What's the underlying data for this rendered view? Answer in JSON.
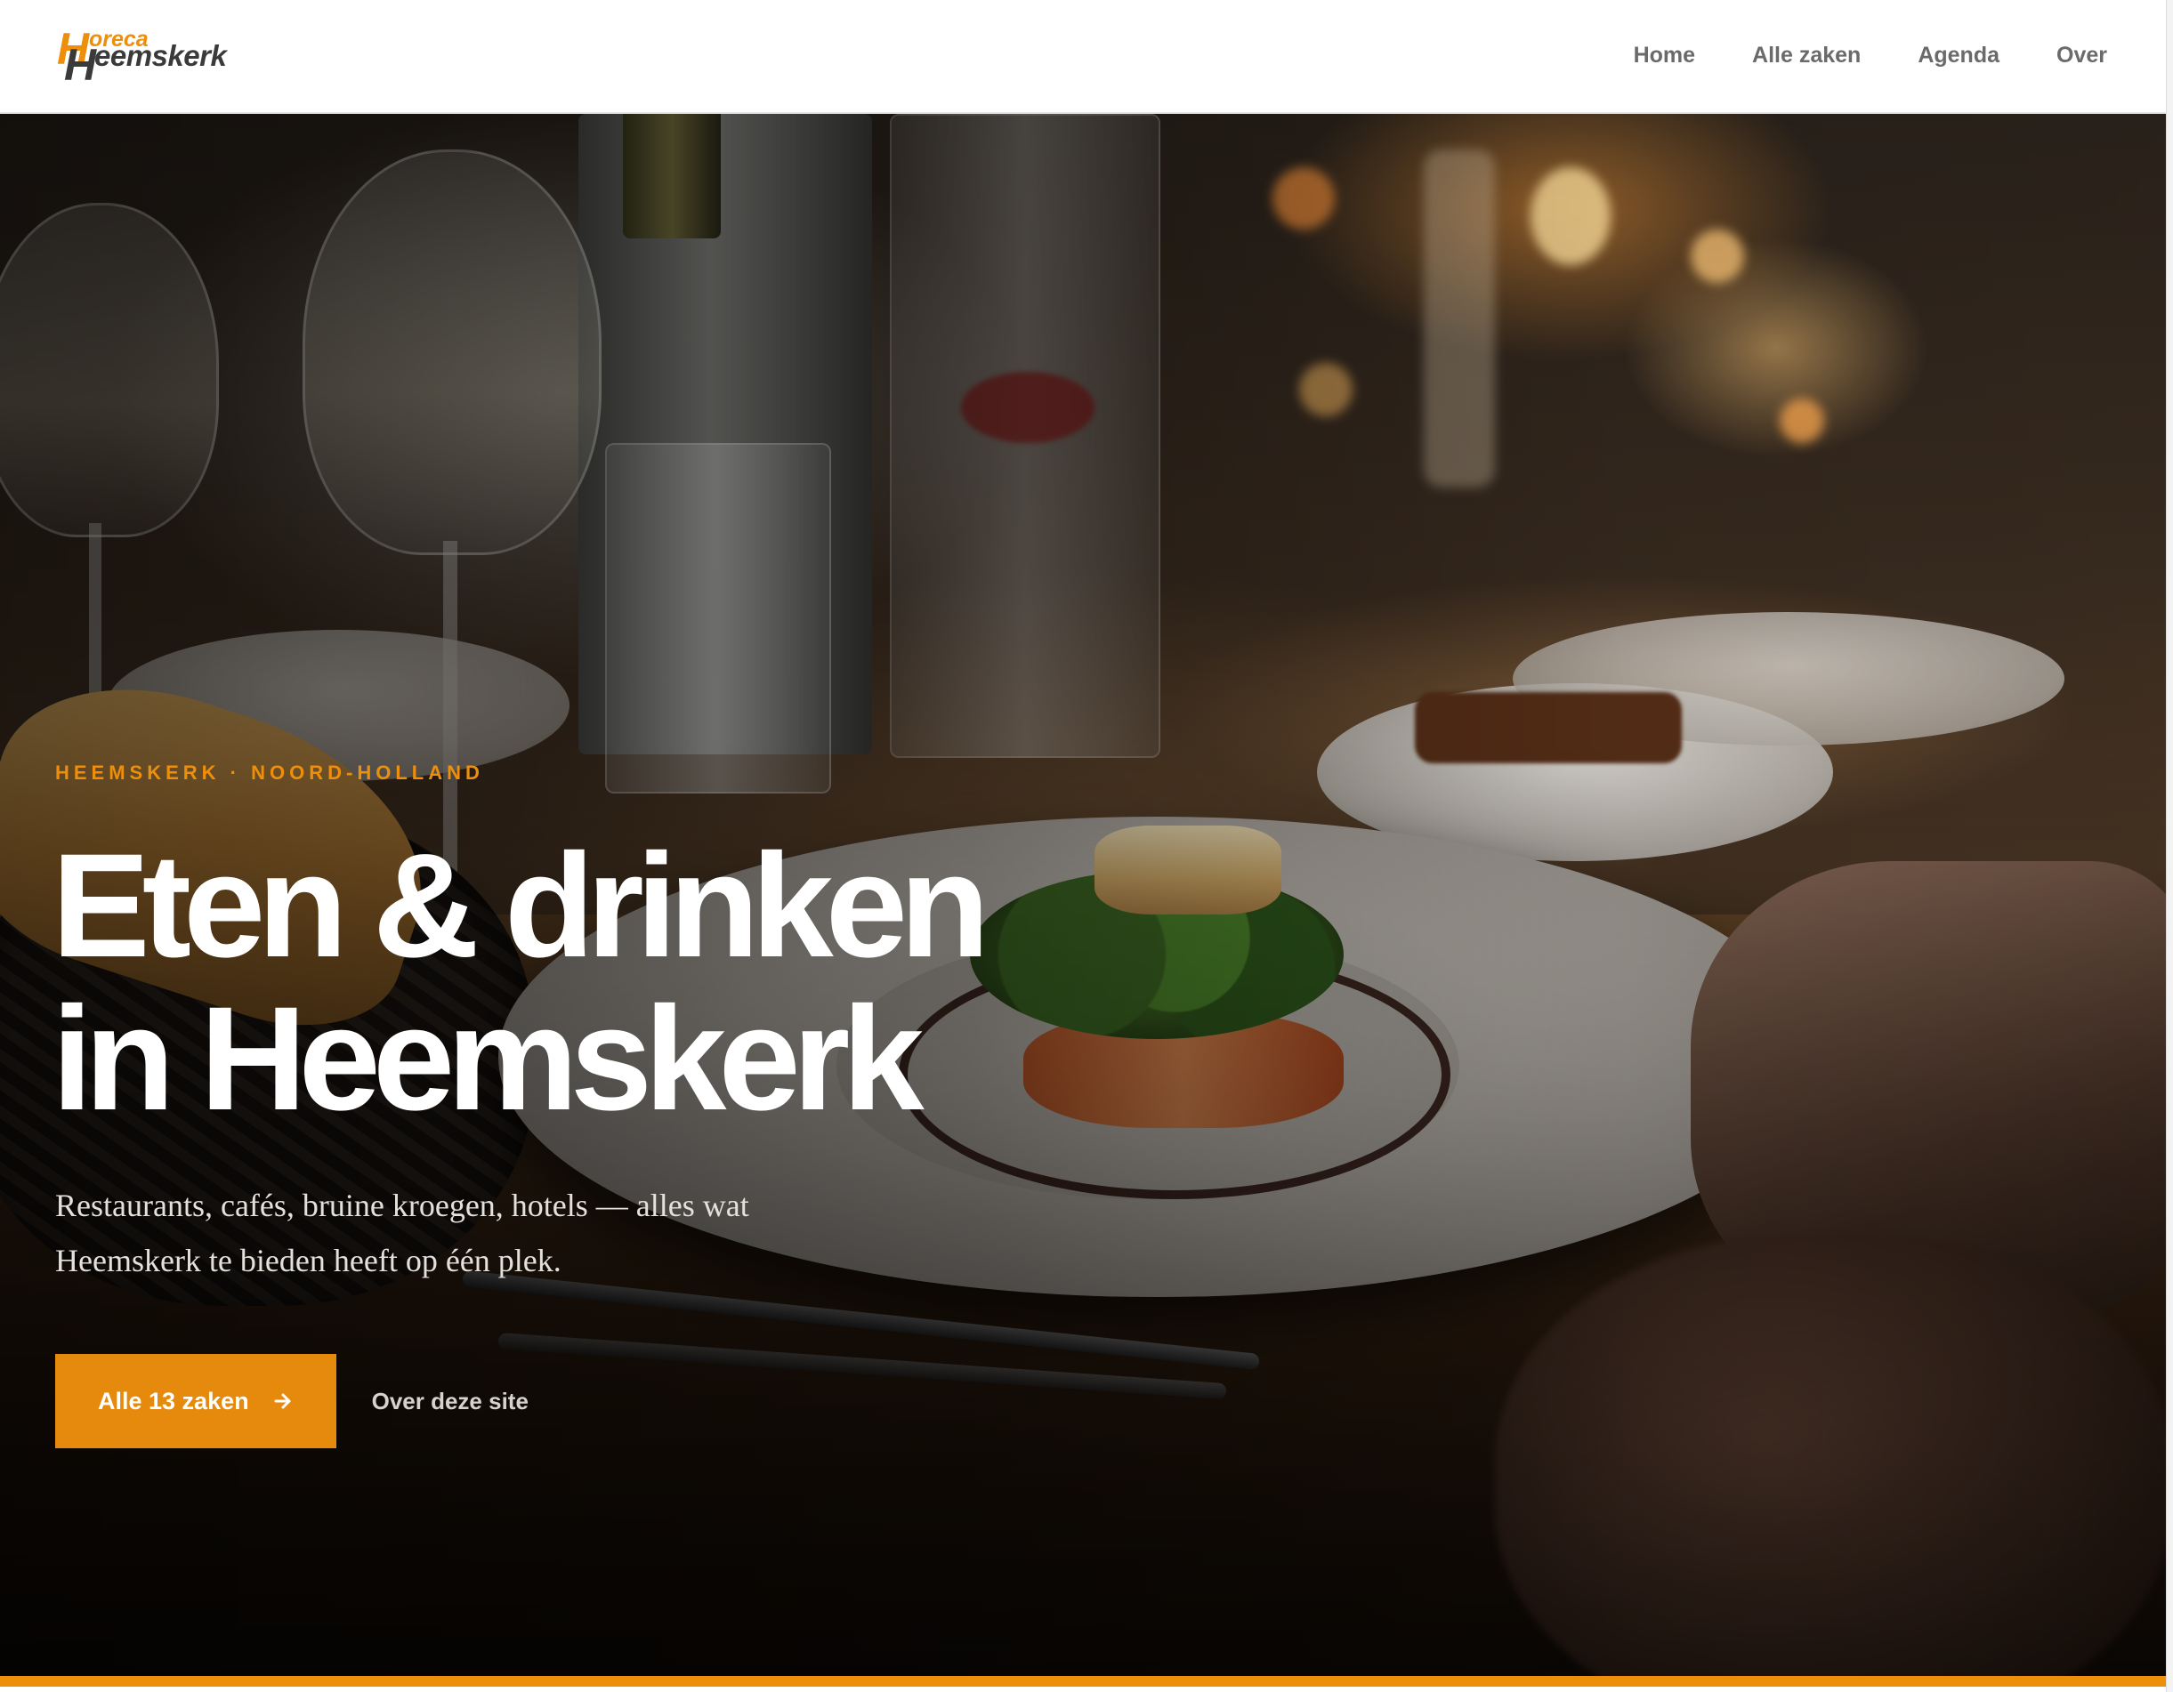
{
  "brand": {
    "logo_letter_top": "H",
    "logo_word_top": "oreca",
    "logo_letter_bottom": "H",
    "logo_word_bottom": "eemskerk",
    "primary_color": "#ee8f0b",
    "dark_color": "#3a3a3a"
  },
  "nav": {
    "items": [
      {
        "label": "Home"
      },
      {
        "label": "Alle zaken"
      },
      {
        "label": "Agenda"
      },
      {
        "label": "Over"
      }
    ]
  },
  "hero": {
    "kicker": "HEEMSKERK · NOORD-HOLLAND",
    "title_line1": "Eten & drinken",
    "title_line2": "in Heemskerk",
    "subtitle_line1": "Restaurants, cafés, bruine kroegen, hotels — alles wat",
    "subtitle_line2": "Heemskerk te bieden heeft op één plek.",
    "primary_cta": "Alle 13 zaken",
    "primary_cta_icon": "arrow-right-icon",
    "secondary_cta": "Over deze site",
    "background_image": "restaurant-table-plated-dish-photo"
  }
}
